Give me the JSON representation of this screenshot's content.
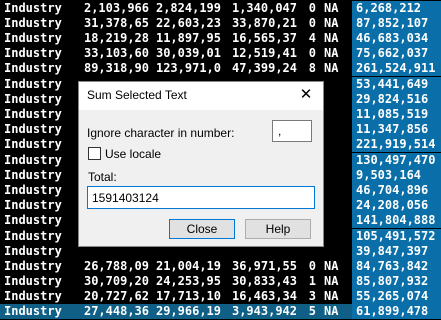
{
  "rows": [
    {
      "label": "Industry",
      "v1": "2,103,966",
      "v2": "2,824,199",
      "v3": "1,340,047",
      "v4": "0",
      "na": "NA",
      "last": "6,268,212"
    },
    {
      "label": "Industry",
      "v1": "31,378,65",
      "v2": "22,603,23",
      "v3": "33,870,21",
      "v4": "0",
      "na": "NA",
      "last": "87,852,107"
    },
    {
      "label": "Industry",
      "v1": "18,219,28",
      "v2": "11,897,95",
      "v3": "16,565,37",
      "v4": "4",
      "na": "NA",
      "last": "46,683,034"
    },
    {
      "label": "Industry",
      "v1": "33,103,60",
      "v2": "30,039,01",
      "v3": "12,519,41",
      "v4": "0",
      "na": "NA",
      "last": "75,662,037"
    },
    {
      "label": "Industry",
      "v1": "89,318,90",
      "v2": "123,971,0",
      "v3": "47,399,24",
      "v4": "8",
      "na": "NA",
      "last": "261,524,911"
    },
    {
      "label": "Industry",
      "v1": "",
      "v2": "",
      "v3": "",
      "v4": "",
      "na": "",
      "last": "53,441,649"
    },
    {
      "label": "Industry",
      "v1": "",
      "v2": "",
      "v3": "",
      "v4": "",
      "na": "",
      "last": "29,824,516"
    },
    {
      "label": "Industry",
      "v1": "",
      "v2": "",
      "v3": "",
      "v4": "",
      "na": "",
      "last": "11,085,519"
    },
    {
      "label": "Industry",
      "v1": "",
      "v2": "",
      "v3": "",
      "v4": "",
      "na": "",
      "last": "11,347,856"
    },
    {
      "label": "Industry",
      "v1": "",
      "v2": "",
      "v3": "",
      "v4": "",
      "na": "",
      "last": "221,919,514"
    },
    {
      "label": "Industry",
      "v1": "",
      "v2": "",
      "v3": "",
      "v4": "",
      "na": "",
      "last": "130,497,470"
    },
    {
      "label": "Industry",
      "v1": "",
      "v2": "",
      "v3": "",
      "v4": "",
      "na": "",
      "last": "9,503,164"
    },
    {
      "label": "Industry",
      "v1": "",
      "v2": "",
      "v3": "",
      "v4": "",
      "na": "",
      "last": "46,704,896"
    },
    {
      "label": "Industry",
      "v1": "",
      "v2": "",
      "v3": "",
      "v4": "",
      "na": "",
      "last": "24,208,056"
    },
    {
      "label": "Industry",
      "v1": "",
      "v2": "",
      "v3": "",
      "v4": "",
      "na": "",
      "last": "141,804,888"
    },
    {
      "label": "Industry",
      "v1": "",
      "v2": "",
      "v3": "",
      "v4": "",
      "na": "",
      "last": "105,491,572"
    },
    {
      "label": "Industry",
      "v1": "",
      "v2": "",
      "v3": "",
      "v4": "",
      "na": "",
      "last": "39,847,397"
    },
    {
      "label": "Industry",
      "v1": "26,788,09",
      "v2": "21,004,19",
      "v3": "36,971,55",
      "v4": "0",
      "na": "NA",
      "last": "84,763,842"
    },
    {
      "label": "Industry",
      "v1": "30,709,20",
      "v2": "24,253,95",
      "v3": "30,833,43",
      "v4": "1",
      "na": "NA",
      "last": "85,807,932"
    },
    {
      "label": "Industry",
      "v1": "20,727,62",
      "v2": "17,713,10",
      "v3": "16,463,34",
      "v4": "3",
      "na": "NA",
      "last": "55,265,074"
    },
    {
      "label": "Industry",
      "v1": "27,448,36",
      "v2": "29,966,19",
      "v3": "3,943,942",
      "v4": "5",
      "na": "NA",
      "last": "61,899,478"
    }
  ],
  "dialog": {
    "title": "Sum Selected Text",
    "close_glyph": "✕",
    "ignore_label": "Ignore character in number:",
    "ignore_value": ",",
    "use_locale_label": "Use locale",
    "total_label": "Total:",
    "total_value": "1591403124",
    "close_button": "Close",
    "help_button": "Help"
  }
}
